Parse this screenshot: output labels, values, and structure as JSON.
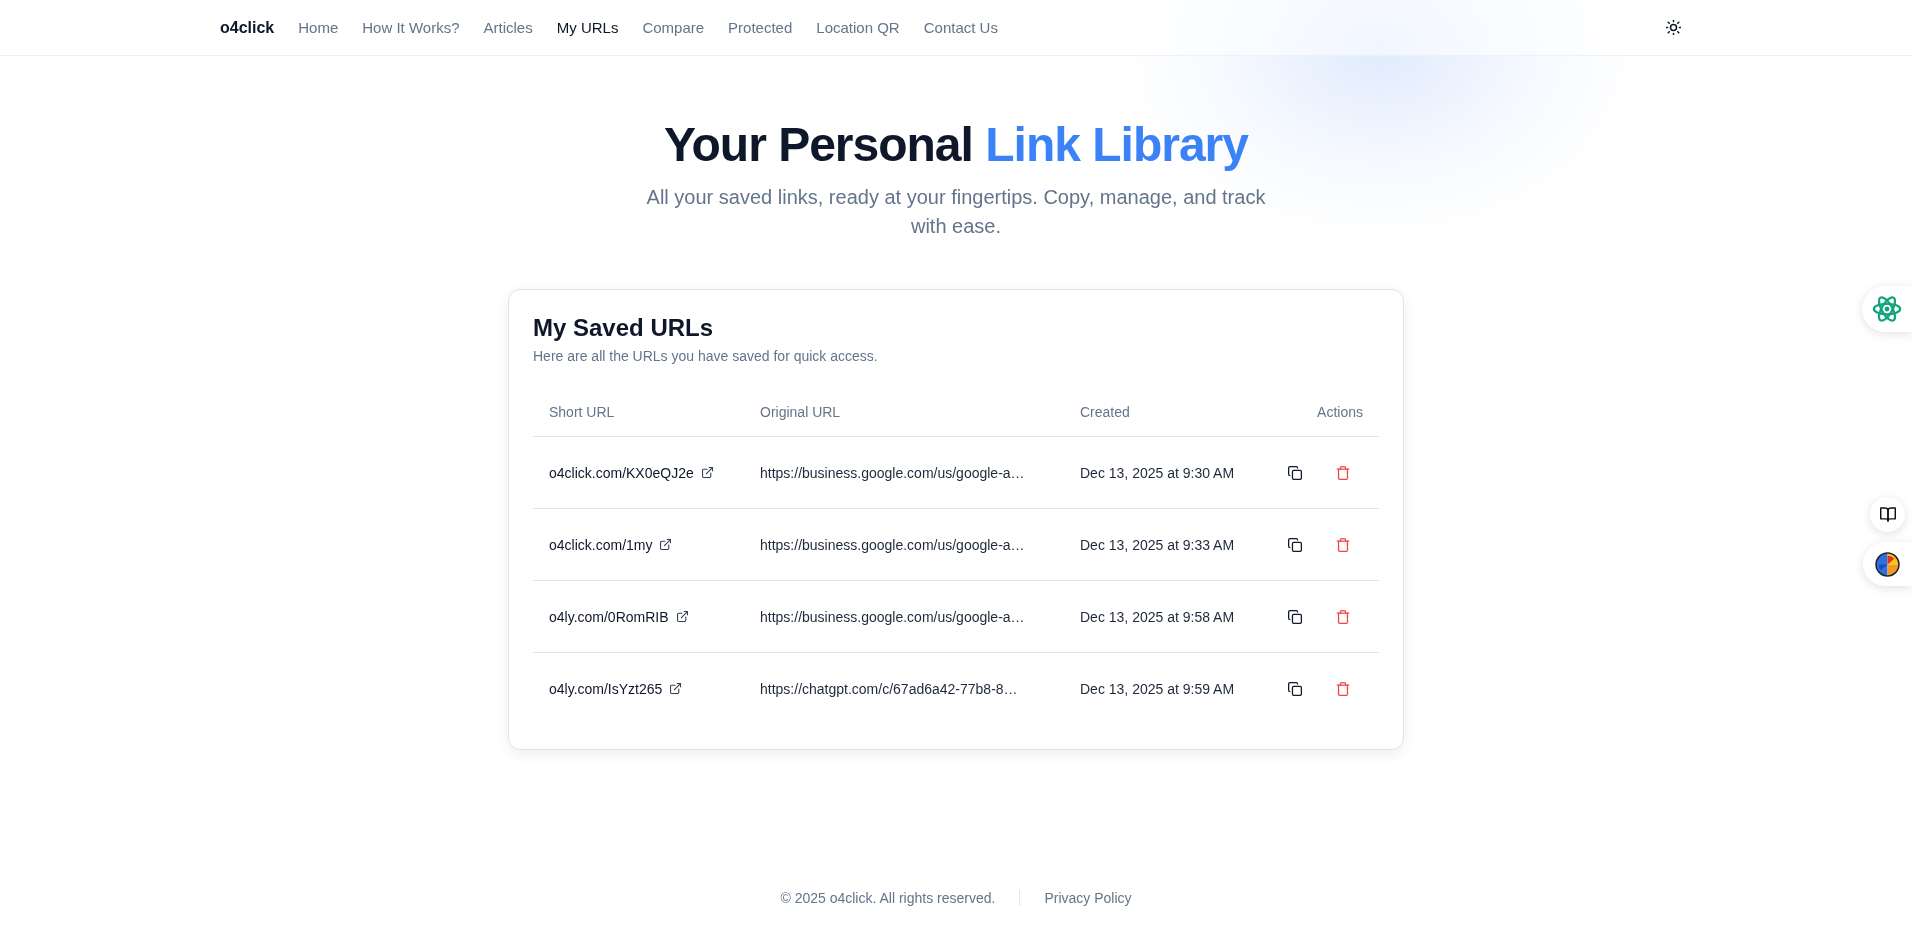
{
  "nav": {
    "logo": "o4click",
    "links": [
      {
        "label": "Home",
        "selected": false
      },
      {
        "label": "How It Works?",
        "selected": false
      },
      {
        "label": "Articles",
        "selected": false
      },
      {
        "label": "My URLs",
        "selected": true
      },
      {
        "label": "Compare",
        "selected": false
      },
      {
        "label": "Protected",
        "selected": false
      },
      {
        "label": "Location QR",
        "selected": false
      },
      {
        "label": "Contact Us",
        "selected": false
      }
    ]
  },
  "hero": {
    "title": "Your Personal",
    "title_highlight": "Link Library",
    "subtitle": "All your saved links, ready at your fingertips. Copy, manage, and track with ease."
  },
  "saved_urls": {
    "title": "My Saved URLs",
    "subtitle": "Here are all the URLs you have saved for quick access.",
    "columns": [
      "Short URL",
      "Original URL",
      "Created",
      "Actions"
    ],
    "rows": [
      {
        "short_url": "o4click.com/KX0eQJ2e",
        "original_url": "https://business.google.com/us/google-a…",
        "created": "Dec 13, 2025 at 9:30 AM"
      },
      {
        "short_url": "o4click.com/1my",
        "original_url": "https://business.google.com/us/google-a…",
        "created": "Dec 13, 2025 at 9:33 AM"
      },
      {
        "short_url": "o4ly.com/0RomRIB",
        "original_url": "https://business.google.com/us/google-a…",
        "created": "Dec 13, 2025 at 9:58 AM"
      },
      {
        "short_url": "o4ly.com/IsYzt265",
        "original_url": "https://chatgpt.com/c/67ad6a42-77b8-8…",
        "created": "Dec 13, 2025 at 9:59 AM"
      }
    ]
  },
  "footer": {
    "copyright": "© 2025 o4click. All rights reserved.",
    "links": [
      "Privacy Policy"
    ]
  }
}
